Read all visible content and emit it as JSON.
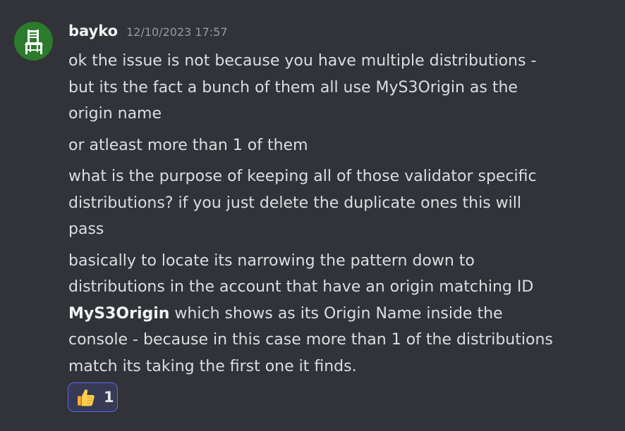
{
  "message": {
    "author": "bayko",
    "timestamp": "12/10/2023 17:57",
    "avatar_icon": "chair-icon",
    "paragraphs": [
      {
        "lines": [
          "ok the issue is not  because you have multiple distributions -",
          "but its the fact a bunch of them all use MyS3Origin as the",
          "origin name"
        ]
      },
      {
        "lines": [
          "or atleast more than 1 of them"
        ]
      },
      {
        "lines": [
          "what is the purpose of keeping all of those validator specific",
          "distributions? if you just delete the duplicate ones this will",
          "pass"
        ]
      },
      {
        "lines": [
          "basically to locate its narrowing the pattern down to",
          "distributions in the account that have an origin matching ID"
        ],
        "bold_line": {
          "bold": "MyS3Origin",
          "rest": " which shows as its Origin Name inside the"
        },
        "tail_lines": [
          "console - because in this case more than 1 of the distributions",
          "match its taking the first one it finds."
        ]
      }
    ],
    "reaction": {
      "emoji": "thumbs-up-icon",
      "count": "1"
    }
  },
  "colors": {
    "background": "#313338",
    "text": "#dbdee1",
    "username": "#f2f3f5",
    "timestamp": "#949ba4",
    "avatar_bg": "#2c7a2b",
    "reaction_border": "#5865f2",
    "reaction_bg": "#373a54"
  }
}
